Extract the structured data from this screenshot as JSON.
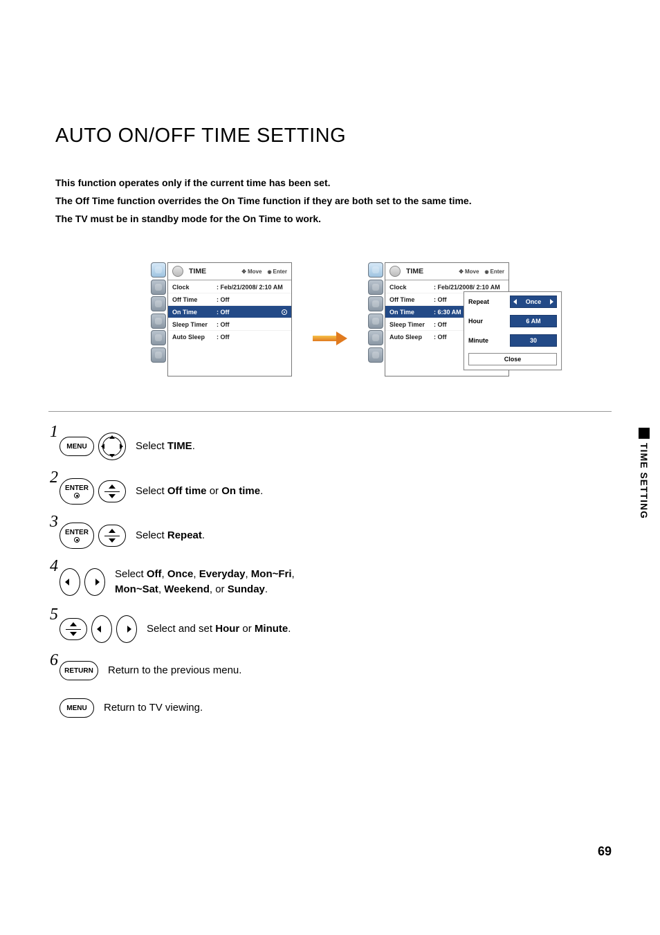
{
  "title": "AUTO ON/OFF TIME SETTING",
  "intro": {
    "line1": "This function operates only if the current time has been set.",
    "line2a": "The ",
    "line2b": "Off Time",
    "line2c": " function overrides the ",
    "line2d": "On Time",
    "line2e": " function if they are both set to the same time.",
    "line3a": "The TV must be in standby mode for the ",
    "line3b": "On Time",
    "line3c": " to work."
  },
  "osd": {
    "title": "TIME",
    "hint_move": "Move",
    "hint_enter": "Enter",
    "rows": {
      "clock_lbl": "Clock",
      "clock_val": "Feb/21/2008/ 2:10 AM",
      "offtime_lbl": "Off Time",
      "offtime_val": "Off",
      "ontime_lbl": "On Time",
      "ontime_val_before": "Off",
      "ontime_val_after": "6:30 AM",
      "sleeptimer_lbl": "Sleep Timer",
      "sleeptimer_val": "Off",
      "autosleep_lbl": "Auto Sleep",
      "autosleep_val": "Off"
    }
  },
  "popup": {
    "repeat_lbl": "Repeat",
    "repeat_val": "Once",
    "hour_lbl": "Hour",
    "hour_val": "6 AM",
    "minute_lbl": "Minute",
    "minute_val": "30",
    "close": "Close"
  },
  "buttons": {
    "menu": "MENU",
    "enter": "ENTER",
    "return": "RETURN"
  },
  "steps": {
    "s1a": "Select ",
    "s1b": "TIME",
    "s1c": ".",
    "s2a": "Select ",
    "s2b": "Off time",
    "s2c": " or ",
    "s2d": "On time",
    "s2e": ".",
    "s3a": "Select ",
    "s3b": "Repeat",
    "s3c": ".",
    "s4a": "Select ",
    "s4b": "Off",
    "s4c": ", ",
    "s4d": "Once",
    "s4e": ", ",
    "s4f": "Everyday",
    "s4g": ", ",
    "s4h": "Mon~Fri",
    "s4i": ", ",
    "s4j": "Mon~Sat",
    "s4k": ", ",
    "s4l": "Weekend",
    "s4m": ", or ",
    "s4n": "Sunday",
    "s4o": ".",
    "s5a": "Select and set ",
    "s5b": "Hour",
    "s5c": " or ",
    "s5d": "Minute",
    "s5e": ".",
    "s6": "Return to the previous menu.",
    "s7": "Return to TV viewing."
  },
  "side_label": "TIME SETTING",
  "page_number": "69"
}
